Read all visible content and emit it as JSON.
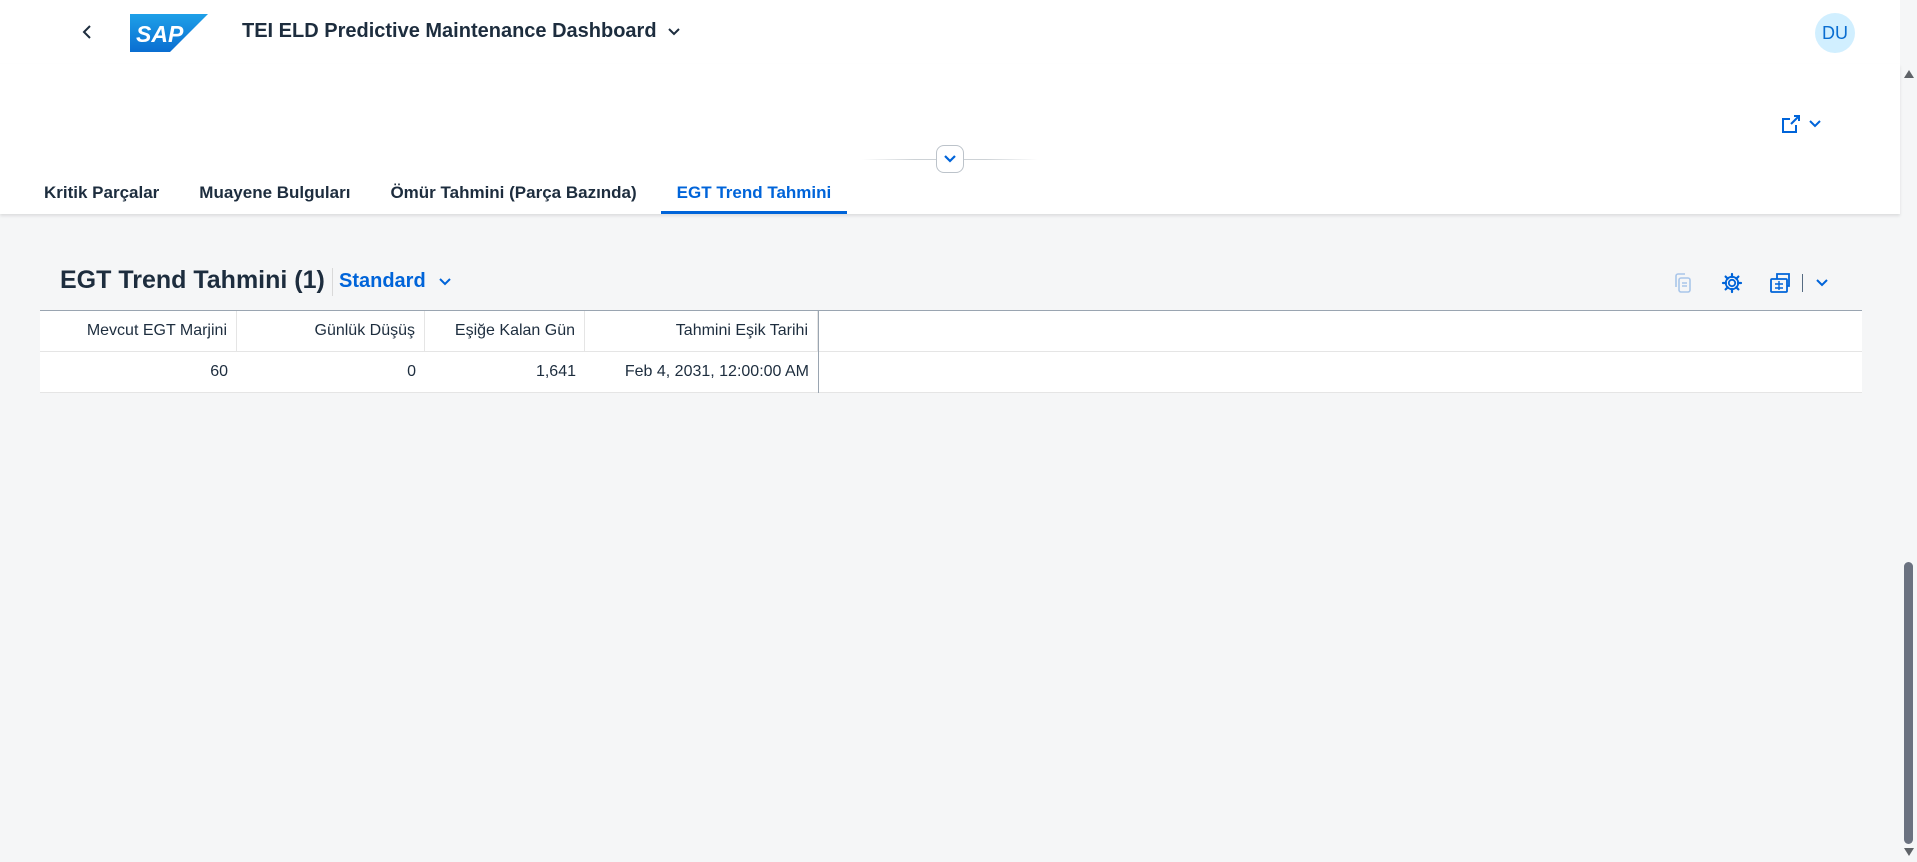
{
  "shell": {
    "app_title": "TEI ELD Predictive Maintenance Dashboard",
    "logo_text": "SAP",
    "avatar_initials": "DU",
    "brand_color": "#0064d9"
  },
  "tabs": [
    {
      "label": "Kritik Parçalar"
    },
    {
      "label": "Muayene Bulguları"
    },
    {
      "label": "Ömür Tahmini (Parça Bazında)"
    },
    {
      "label": "EGT Trend Tahmini",
      "active": true
    }
  ],
  "table": {
    "title": "EGT Trend Tahmini (1)",
    "variant": "Standard",
    "columns": [
      "Mevcut EGT Marjini",
      "Günlük Düşüş",
      "Eşiğe Kalan Gün",
      "Tahmini Eşik Tarihi"
    ],
    "rows": [
      [
        "60",
        "0",
        "1,641",
        "Feb 4, 2031, 12:00:00 AM"
      ]
    ]
  }
}
